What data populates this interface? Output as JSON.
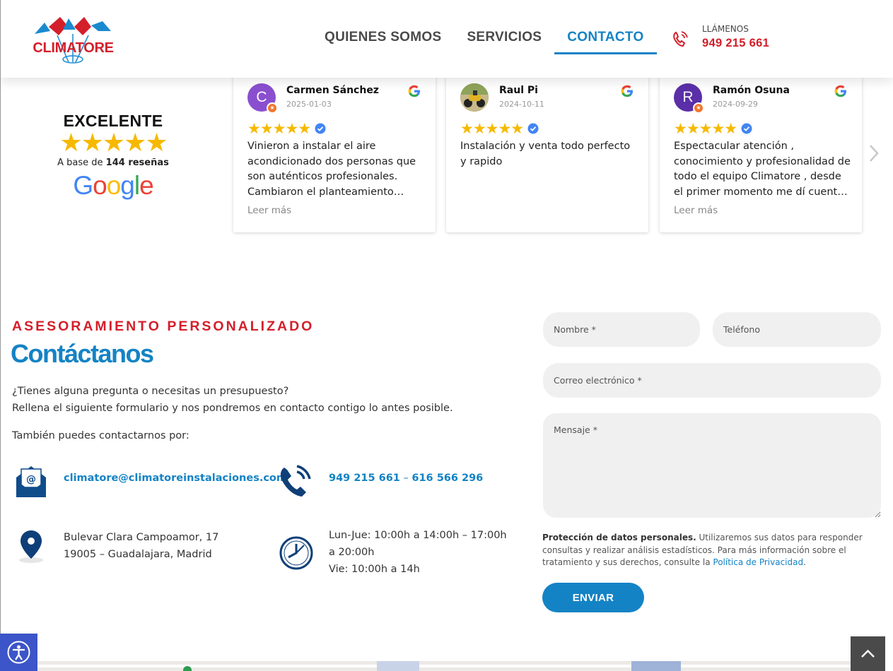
{
  "header": {
    "logo_text": "CLIMATORE",
    "nav": [
      {
        "label": "QUIENES SOMOS",
        "active": false
      },
      {
        "label": "SERVICIOS",
        "active": false
      },
      {
        "label": "CONTACTO",
        "active": true
      }
    ],
    "call_caption": "LLÁMENOS",
    "call_number": "949 215 661"
  },
  "reviews_summary": {
    "title": "EXCELENTE",
    "stars": "★★★★★",
    "base_prefix": "A base de",
    "base_count": "144 reseñas",
    "google_letters": [
      "G",
      "o",
      "o",
      "g",
      "l",
      "e"
    ]
  },
  "reviews": [
    {
      "initial": "C",
      "avatar_color": "#8a4fcf",
      "name": "Carmen Sánchez",
      "date": "2025-01-03",
      "stars": "★★★★★",
      "text": "Vinieron a instalar el aire acondicionado dos personas que son auténticos profesionales. Cambiaron el planteamiento inicial",
      "read_more": "Leer más"
    },
    {
      "initial": "",
      "avatar_color": "#5a6a2a",
      "name": "Raul Pi",
      "date": "2024-10-11",
      "stars": "★★★★★",
      "text": "Instalación y venta todo perfecto y rapido",
      "read_more": ""
    },
    {
      "initial": "R",
      "avatar_color": "#5a2fa8",
      "name": "Ramón Osuna",
      "date": "2024-09-29",
      "stars": "★★★★★",
      "text": "Espectacular atención , conocimiento y profesionalidad de todo el equipo Climatore , desde el primer momento me dí cuenta de",
      "read_more": "Leer más"
    }
  ],
  "contact": {
    "kicker": "ASESORAMIENTO PERSONALIZADO",
    "title": "Contáctanos",
    "intro_line1": "¿Tienes alguna pregunta o necesitas un presupuesto?",
    "intro_line2": "Rellena el siguiente formulario y nos pondremos en contacto contigo lo antes posible.",
    "also": "También puedes contactarnos por:",
    "email": "climatore@climatoreinstalaciones.com",
    "phone1": "949 215 661",
    "phone_sep": " – ",
    "phone2": "616 566 296",
    "address_line1": "Bulevar Clara Campoamor, 17",
    "address_line2": "19005 – Guadalajara, Madrid",
    "hours_line1": "Lun-Jue: 10:00h a 14:00h – 17:00h",
    "hours_line2": "a 20:00h",
    "hours_line3": "Vie: 10:00h a 14h"
  },
  "form": {
    "name_placeholder": "Nombre *",
    "phone_placeholder": "Teléfono",
    "email_placeholder": "Correo electrónico *",
    "message_placeholder": "Mensaje *",
    "privacy_bold": "Protección de datos personales.",
    "privacy_text": " Utilizaremos sus datos para responder consultas y realizar análisis estadísticos. Para más información sobre el tratamiento y sus derechos, consulte la ",
    "privacy_link": "Política de Privacidad",
    "privacy_end": ".",
    "submit_label": "ENVIAR"
  },
  "colors": {
    "brand_blue": "#1483c5",
    "brand_red": "#d31f2a",
    "star_yellow": "#f6b900"
  }
}
